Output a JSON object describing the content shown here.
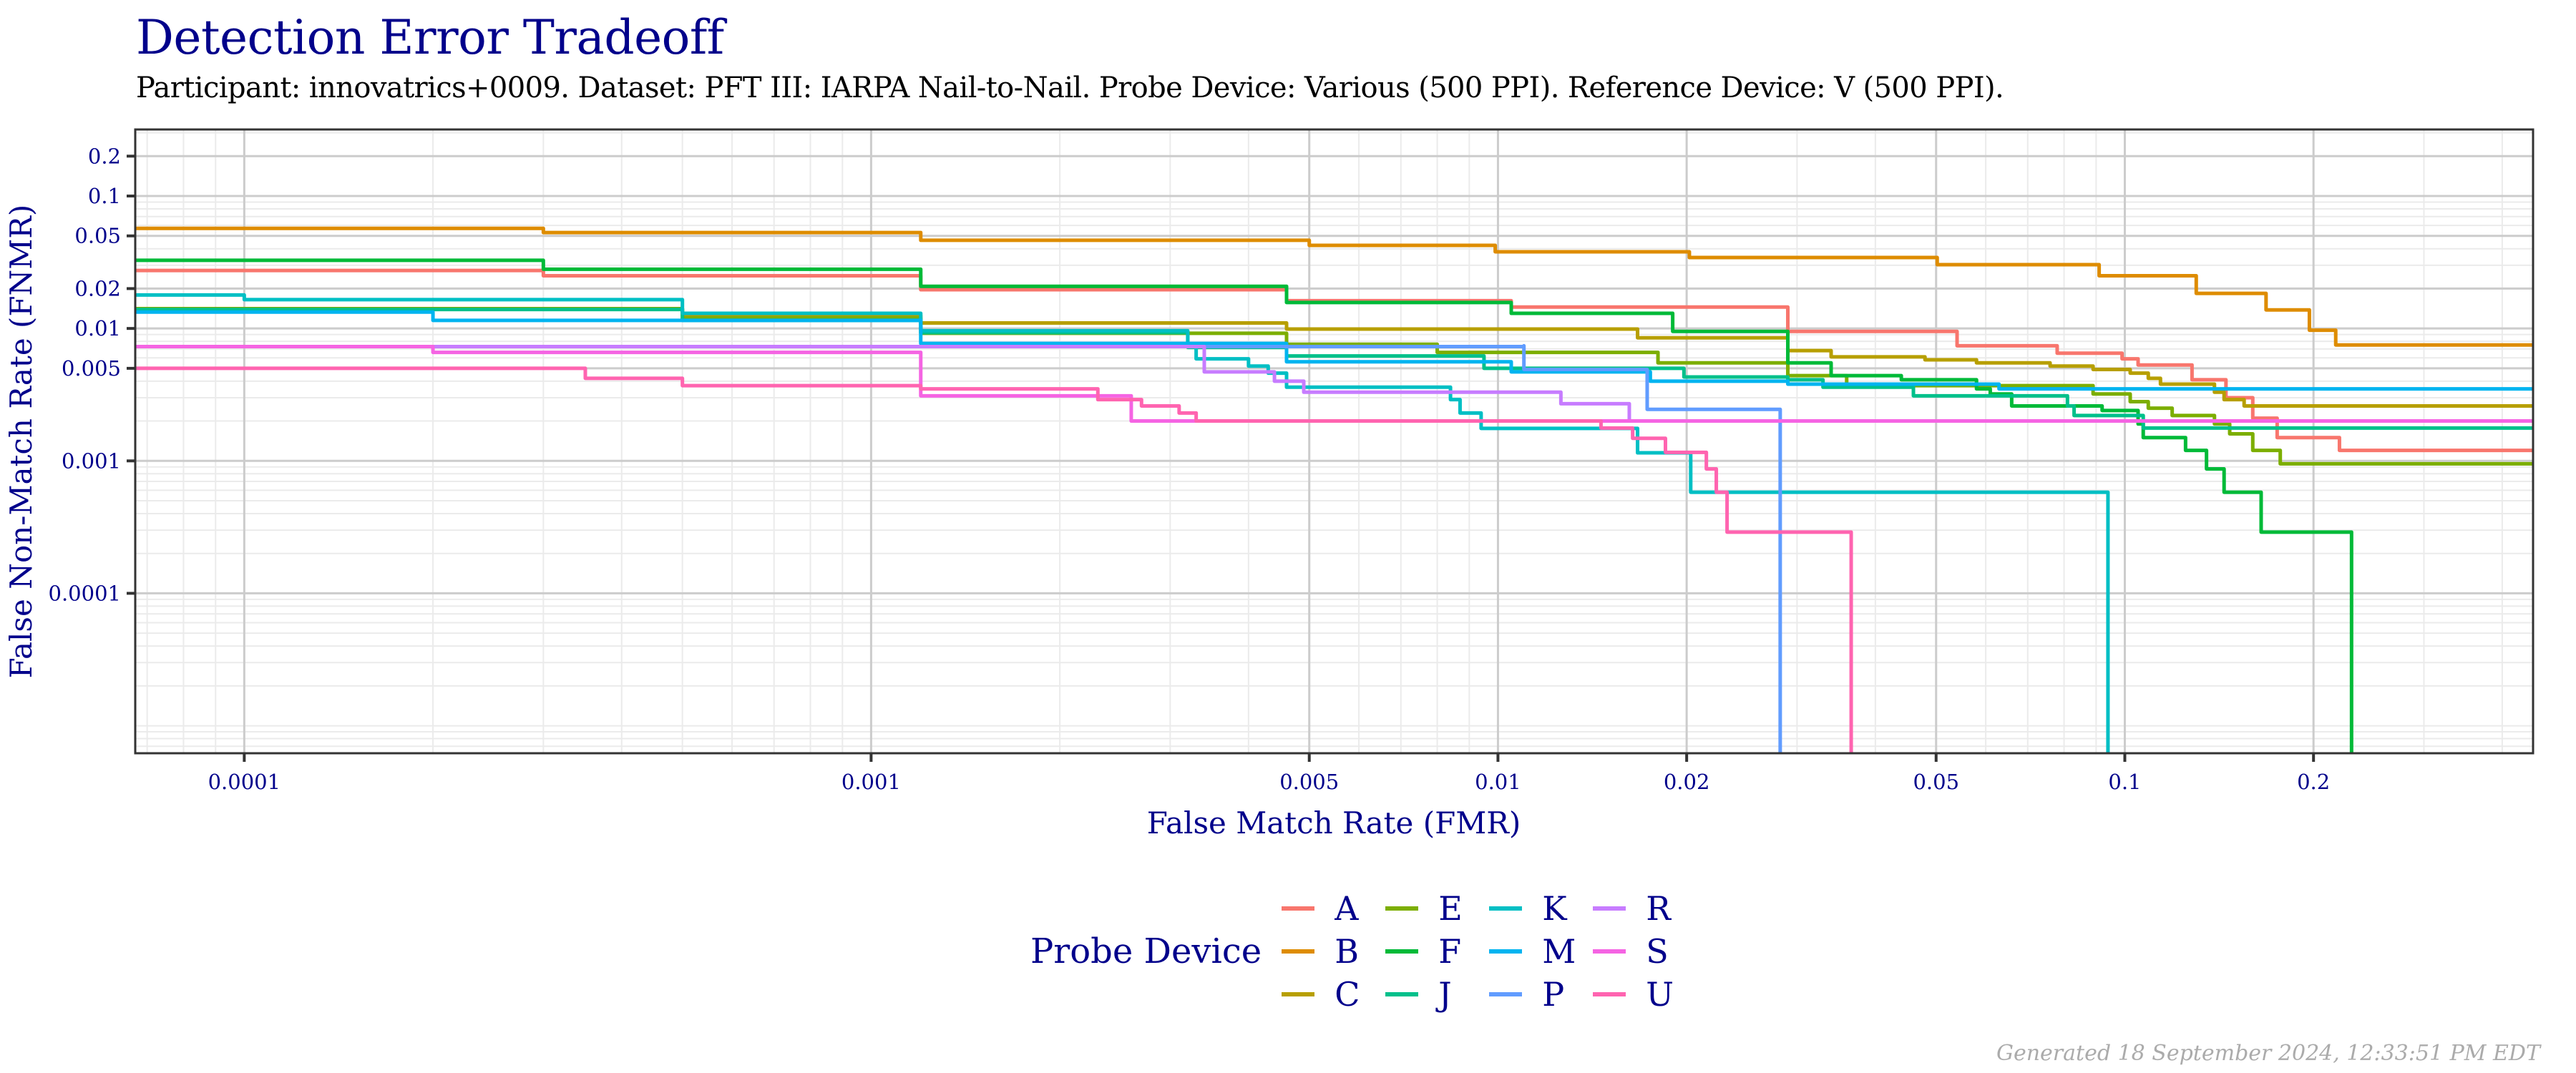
{
  "chart_data": {
    "type": "line",
    "title": "Detection Error Tradeoff",
    "subtitle": "Participant: innovatrics+0009. Dataset: PFT III: IARPA Nail-to-Nail. Probe Device: Various (500 PPI). Reference Device: V (500 PPI).",
    "xlabel": "False Match Rate (FMR)",
    "ylabel": "False Non-Match Rate (FNMR)",
    "xscale": "log",
    "yscale": "log",
    "xlim": [
      6.7e-05,
      0.448
    ],
    "ylim": [
      6.2e-06,
      0.318
    ],
    "x_ticks": [
      {
        "value": 0.0001,
        "label": "0.0001"
      },
      {
        "value": 0.001,
        "label": "0.001"
      },
      {
        "value": 0.005,
        "label": "0.005"
      },
      {
        "value": 0.01,
        "label": "0.01"
      },
      {
        "value": 0.02,
        "label": "0.02"
      },
      {
        "value": 0.05,
        "label": "0.05"
      },
      {
        "value": 0.1,
        "label": "0.1"
      },
      {
        "value": 0.2,
        "label": "0.2"
      }
    ],
    "y_ticks": [
      {
        "value": 0.2,
        "label": "0.2"
      },
      {
        "value": 0.1,
        "label": "0.1"
      },
      {
        "value": 0.05,
        "label": "0.05"
      },
      {
        "value": 0.02,
        "label": "0.02"
      },
      {
        "value": 0.01,
        "label": "0.01"
      },
      {
        "value": 0.005,
        "label": "0.005"
      },
      {
        "value": 0.001,
        "label": "0.001"
      },
      {
        "value": 0.0001,
        "label": "0.0001"
      }
    ],
    "grid": true,
    "step": true,
    "legend": {
      "title": "Probe Device",
      "position": "bottom"
    },
    "series": [
      {
        "name": "A",
        "color": "#F8766D",
        "points": [
          [
            6.7e-05,
            0.0274
          ],
          [
            0.0003,
            0.025
          ],
          [
            0.0012,
            0.0196
          ],
          [
            0.0046,
            0.0162
          ],
          [
            0.0105,
            0.0145
          ],
          [
            0.029,
            0.0095
          ],
          [
            0.054,
            0.0074
          ],
          [
            0.078,
            0.0065
          ],
          [
            0.099,
            0.0059
          ],
          [
            0.105,
            0.0053
          ],
          [
            0.128,
            0.0041
          ],
          [
            0.145,
            0.003
          ],
          [
            0.16,
            0.0021
          ],
          [
            0.175,
            0.0015
          ],
          [
            0.22,
            0.0012
          ],
          [
            0.448,
            0.0012
          ]
        ]
      },
      {
        "name": "B",
        "color": "#DE8C00",
        "points": [
          [
            6.7e-05,
            0.057
          ],
          [
            0.0003,
            0.053
          ],
          [
            0.0012,
            0.0463
          ],
          [
            0.005,
            0.0424
          ],
          [
            0.0099,
            0.0379
          ],
          [
            0.0202,
            0.0343
          ],
          [
            0.0502,
            0.0303
          ],
          [
            0.091,
            0.025
          ],
          [
            0.13,
            0.0184
          ],
          [
            0.168,
            0.0138
          ],
          [
            0.197,
            0.0097
          ],
          [
            0.217,
            0.0075
          ],
          [
            0.448,
            0.0075
          ]
        ]
      },
      {
        "name": "C",
        "color": "#B79F00",
        "points": [
          [
            6.7e-05,
            0.0141
          ],
          [
            0.0005,
            0.0125
          ],
          [
            0.0012,
            0.011
          ],
          [
            0.0046,
            0.0099
          ],
          [
            0.0167,
            0.0085
          ],
          [
            0.029,
            0.0068
          ],
          [
            0.034,
            0.0061
          ],
          [
            0.048,
            0.0058
          ],
          [
            0.058,
            0.0055
          ],
          [
            0.076,
            0.0052
          ],
          [
            0.089,
            0.0049
          ],
          [
            0.102,
            0.0046
          ],
          [
            0.109,
            0.0042
          ],
          [
            0.114,
            0.0038
          ],
          [
            0.139,
            0.0033
          ],
          [
            0.144,
            0.0029
          ],
          [
            0.155,
            0.0026
          ],
          [
            0.448,
            0.0026
          ]
        ]
      },
      {
        "name": "E",
        "color": "#7CAE00",
        "points": [
          [
            6.7e-05,
            0.0141
          ],
          [
            0.0005,
            0.012
          ],
          [
            0.0012,
            0.0092
          ],
          [
            0.0046,
            0.0076
          ],
          [
            0.008,
            0.0066
          ],
          [
            0.018,
            0.0055
          ],
          [
            0.029,
            0.0044
          ],
          [
            0.036,
            0.0037
          ],
          [
            0.089,
            0.0032
          ],
          [
            0.102,
            0.0028
          ],
          [
            0.109,
            0.0025
          ],
          [
            0.119,
            0.0022
          ],
          [
            0.139,
            0.0019
          ],
          [
            0.147,
            0.0016
          ],
          [
            0.16,
            0.0012
          ],
          [
            0.177,
            0.00095
          ],
          [
            0.448,
            0.00095
          ]
        ]
      },
      {
        "name": "F",
        "color": "#00BA38",
        "points": [
          [
            6.7e-05,
            0.0327
          ],
          [
            0.0003,
            0.028
          ],
          [
            0.0012,
            0.0208
          ],
          [
            0.0046,
            0.0157
          ],
          [
            0.0105,
            0.013
          ],
          [
            0.019,
            0.0095
          ],
          [
            0.029,
            0.0055
          ],
          [
            0.034,
            0.0044
          ],
          [
            0.044,
            0.0041
          ],
          [
            0.058,
            0.0035
          ],
          [
            0.061,
            0.0032
          ],
          [
            0.066,
            0.0026
          ],
          [
            0.092,
            0.0024
          ],
          [
            0.105,
            0.0019
          ],
          [
            0.107,
            0.0015
          ],
          [
            0.125,
            0.0012
          ],
          [
            0.135,
            0.00087
          ],
          [
            0.144,
            0.00058
          ],
          [
            0.165,
            0.00029
          ],
          [
            0.23,
            0.00029
          ],
          [
            0.23,
            1e-06
          ]
        ]
      },
      {
        "name": "J",
        "color": "#00C08B",
        "points": [
          [
            6.7e-05,
            0.0139
          ],
          [
            0.0005,
            0.0115
          ],
          [
            0.0012,
            0.0093
          ],
          [
            0.0032,
            0.0072
          ],
          [
            0.0046,
            0.0062
          ],
          [
            0.0095,
            0.005
          ],
          [
            0.0198,
            0.0043
          ],
          [
            0.029,
            0.0041
          ],
          [
            0.033,
            0.0036
          ],
          [
            0.046,
            0.0031
          ],
          [
            0.081,
            0.0026
          ],
          [
            0.083,
            0.0022
          ],
          [
            0.107,
            0.00177
          ],
          [
            0.448,
            0.00177
          ]
        ]
      },
      {
        "name": "K",
        "color": "#00BFC4",
        "points": [
          [
            6.7e-05,
            0.0179
          ],
          [
            0.0001,
            0.0165
          ],
          [
            0.0005,
            0.013
          ],
          [
            0.0012,
            0.0096
          ],
          [
            0.0032,
            0.0074
          ],
          [
            0.0033,
            0.0059
          ],
          [
            0.004,
            0.0052
          ],
          [
            0.0043,
            0.0046
          ],
          [
            0.0046,
            0.0036
          ],
          [
            0.0084,
            0.0029
          ],
          [
            0.0087,
            0.0023
          ],
          [
            0.0094,
            0.00176
          ],
          [
            0.0167,
            0.00115
          ],
          [
            0.0203,
            0.00058
          ],
          [
            0.094,
            0.00058
          ],
          [
            0.094,
            1e-06
          ]
        ]
      },
      {
        "name": "M",
        "color": "#00B4F0",
        "points": [
          [
            6.7e-05,
            0.0133
          ],
          [
            0.0002,
            0.0115
          ],
          [
            0.0012,
            0.0077
          ],
          [
            0.0046,
            0.0056
          ],
          [
            0.0105,
            0.0047
          ],
          [
            0.0175,
            0.004
          ],
          [
            0.029,
            0.0038
          ],
          [
            0.063,
            0.0035
          ],
          [
            0.448,
            0.0035
          ]
        ]
      },
      {
        "name": "P",
        "color": "#619CFF",
        "points": [
          [
            6.7e-05,
            0.0073
          ],
          [
            0.011,
            0.0074
          ],
          [
            0.011,
            0.0049
          ],
          [
            0.0173,
            0.0049
          ],
          [
            0.0173,
            0.00245
          ],
          [
            0.0282,
            0.00245
          ],
          [
            0.0282,
            1e-06
          ]
        ]
      },
      {
        "name": "R",
        "color": "#C77CFF",
        "points": [
          [
            6.7e-05,
            0.0073
          ],
          [
            0.0034,
            0.0054
          ],
          [
            0.0034,
            0.0047
          ],
          [
            0.0044,
            0.004
          ],
          [
            0.0049,
            0.0033
          ],
          [
            0.0126,
            0.0027
          ],
          [
            0.0162,
            0.002
          ],
          [
            0.448,
            0.002
          ]
        ]
      },
      {
        "name": "S",
        "color": "#F564E3",
        "points": [
          [
            6.7e-05,
            0.0073
          ],
          [
            0.0002,
            0.0066
          ],
          [
            0.0012,
            0.0031
          ],
          [
            0.0026,
            0.0026
          ],
          [
            0.0026,
            0.002
          ],
          [
            0.448,
            0.002
          ]
        ]
      },
      {
        "name": "U",
        "color": "#FF64B0",
        "points": [
          [
            6.7e-05,
            0.005
          ],
          [
            0.00035,
            0.0042
          ],
          [
            0.0005,
            0.0037
          ],
          [
            0.0012,
            0.0035
          ],
          [
            0.0023,
            0.0029
          ],
          [
            0.0027,
            0.0026
          ],
          [
            0.0031,
            0.0023
          ],
          [
            0.0033,
            0.002
          ],
          [
            0.0135,
            0.002
          ],
          [
            0.0146,
            0.00177
          ],
          [
            0.0164,
            0.00148
          ],
          [
            0.0185,
            0.00116
          ],
          [
            0.0215,
            0.00087
          ],
          [
            0.0223,
            0.00058
          ],
          [
            0.0232,
            0.00029
          ],
          [
            0.0366,
            0.00029
          ],
          [
            0.0366,
            1e-06
          ]
        ]
      }
    ]
  },
  "footer": {
    "generated": "Generated 18 September 2024, 12:33:51 PM EDT"
  }
}
